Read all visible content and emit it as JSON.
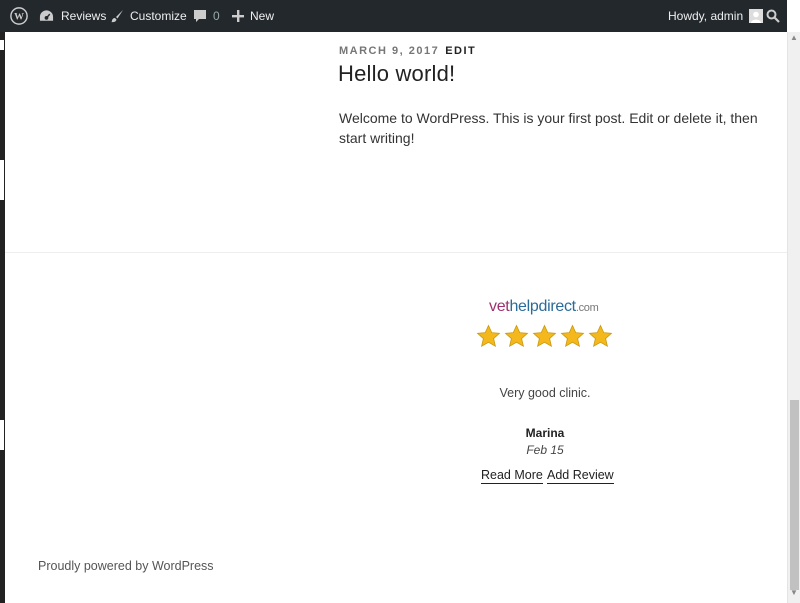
{
  "admin_bar": {
    "wp_logo": "wordpress-icon",
    "items": [
      {
        "icon": "dashboard-icon",
        "label": "Reviews"
      },
      {
        "icon": "paintbrush-icon",
        "label": "Customize"
      },
      {
        "icon": "comment-icon",
        "label": "0"
      },
      {
        "icon": "plus-icon",
        "label": "New"
      }
    ],
    "howdy": "Howdy, admin",
    "search_icon": "search-icon"
  },
  "post": {
    "date": "MARCH 9, 2017",
    "edit_label": "EDIT",
    "title": "Hello world!",
    "body": "Welcome to WordPress. This is your first post. Edit or delete it, then start writing!"
  },
  "review_widget": {
    "logo": {
      "part1": "vet",
      "part2": "helpdirect",
      "part3": ".com"
    },
    "rating": 5,
    "rating_max": 5,
    "text": "Very good clinic.",
    "reviewer": "Marina",
    "date": "Feb 15",
    "read_more": "Read More",
    "add_review": "Add Review"
  },
  "footer": {
    "credit": "Proudly powered by WordPress"
  },
  "colors": {
    "admin_bar_bg": "#23282d",
    "star": "#f5b81c",
    "logo_vet": "#a0306e",
    "logo_helpdirect": "#2a6b9a"
  }
}
